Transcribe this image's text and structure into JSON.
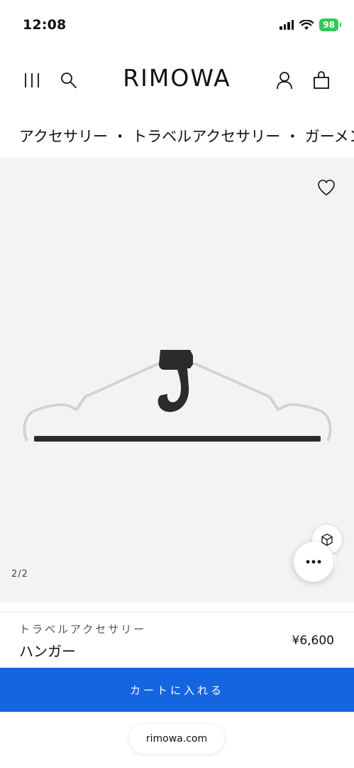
{
  "status_bar": {
    "time": "12:08",
    "battery": "98"
  },
  "header": {
    "brand": "RIMOWA"
  },
  "breadcrumb": "アクセサリー ・ トラベルアクセサリー ・ ガーメントバッグ",
  "gallery": {
    "pager": "2/2"
  },
  "product": {
    "category": "トラベルアクセサリー",
    "name": "ハンガー",
    "price": "¥6,600"
  },
  "cart_button_label": "カートに入れる",
  "browser": {
    "url": "rimowa.com"
  },
  "colors": {
    "accent": "#1565e0",
    "gallery_bg": "#f4f3f1",
    "battery": "#34c759"
  }
}
